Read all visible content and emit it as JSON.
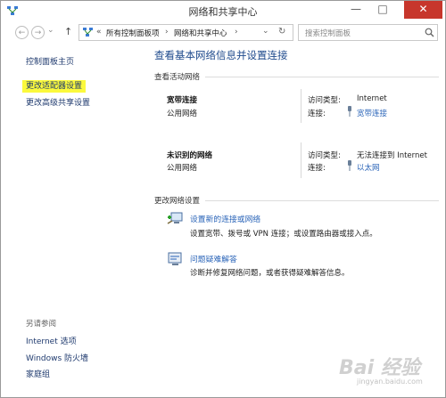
{
  "window": {
    "title": "网络和共享中心",
    "minimize": "—",
    "maximize": "□",
    "close": "✕"
  },
  "address": {
    "back": "←",
    "forward": "→",
    "up": "↑",
    "chevrons": "«",
    "crumb1": "所有控制面板项",
    "sep": "›",
    "crumb2": "网络和共享中心",
    "dropdown": "⌄",
    "refresh": "↻",
    "search_placeholder": "搜索控制面板"
  },
  "sidebar": {
    "items": [
      {
        "label": "控制面板主页"
      },
      {
        "label": "更改适配器设置"
      },
      {
        "label": "更改高级共享设置"
      }
    ],
    "see_also": {
      "title": "另请参阅",
      "items": [
        {
          "label": "Internet 选项"
        },
        {
          "label": "Windows 防火墙"
        },
        {
          "label": "家庭组"
        }
      ]
    }
  },
  "main": {
    "heading": "查看基本网络信息并设置连接",
    "active_networks_title": "查看活动网络",
    "networks": [
      {
        "name": "宽带连接",
        "type": "公用网络",
        "access_label": "访问类型:",
        "access_value": "Internet",
        "conn_label": "连接:",
        "conn_value": "宽带连接"
      },
      {
        "name": "未识别的网络",
        "type": "公用网络",
        "access_label": "访问类型:",
        "access_value": "无法连接到 Internet",
        "conn_label": "连接:",
        "conn_value": "以太网"
      }
    ],
    "change_title": "更改网络设置",
    "tasks": [
      {
        "title": "设置新的连接或网络",
        "desc": "设置宽带、拨号或 VPN 连接；或设置路由器或接入点。"
      },
      {
        "title": "问题疑难解答",
        "desc": "诊断并修复网络问题，或者获得疑难解答信息。"
      }
    ]
  },
  "watermark": {
    "brand": "Bai 经验",
    "site": "jingyan.baidu.com"
  },
  "colors": {
    "highlight": "#fbf93c",
    "link": "#2a64b8",
    "heading": "#1e4a8c",
    "close": "#c7362c"
  }
}
